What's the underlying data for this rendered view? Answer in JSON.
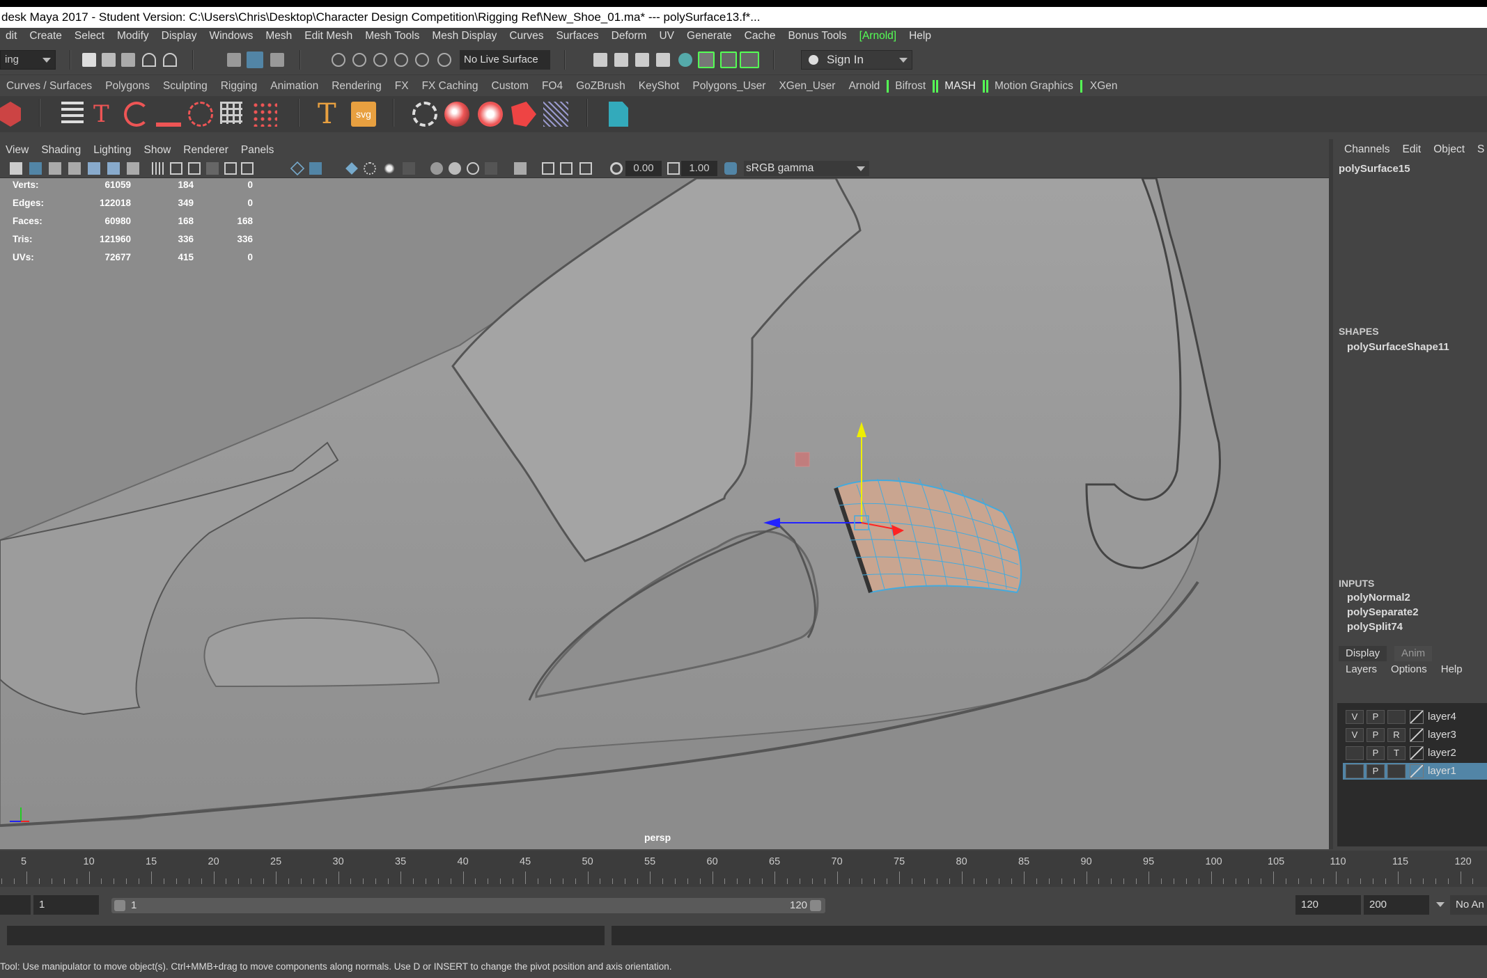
{
  "window": {
    "title": "desk Maya 2017 - Student Version: C:\\Users\\Chris\\Desktop\\Character Design Competition\\Rigging Ref\\New_Shoe_01.ma*   ---   polySurface13.f*..."
  },
  "menubar": [
    "dit",
    "Create",
    "Select",
    "Modify",
    "Display",
    "Windows",
    "Mesh",
    "Edit Mesh",
    "Mesh Tools",
    "Mesh Display",
    "Curves",
    "Surfaces",
    "Deform",
    "UV",
    "Generate",
    "Cache",
    "Bonus Tools",
    "[Arnold]",
    "Help"
  ],
  "statusline": {
    "mode_dropdown": "ing",
    "live_surface": "No Live Surface",
    "sign_in": "Sign In"
  },
  "shelf_tabs": [
    "Curves / Surfaces",
    "Polygons",
    "Sculpting",
    "Rigging",
    "Animation",
    "Rendering",
    "FX",
    "FX Caching",
    "Custom",
    "FO4",
    "GoZBrush",
    "KeyShot",
    "Polygons_User",
    "XGen_User",
    "Arnold",
    "Bifrost",
    "MASH",
    "Motion Graphics",
    "XGen"
  ],
  "viewport": {
    "menu": [
      "View",
      "Shading",
      "Lighting",
      "Show",
      "Renderer",
      "Panels"
    ],
    "exposure": "0.00",
    "gamma_value": "1.00",
    "color_space": "sRGB gamma",
    "camera": "persp",
    "hud": [
      {
        "label": "Verts:",
        "c1": "61059",
        "c2": "184",
        "c3": "0"
      },
      {
        "label": "Edges:",
        "c1": "122018",
        "c2": "349",
        "c3": "0"
      },
      {
        "label": "Faces:",
        "c1": "60980",
        "c2": "168",
        "c3": "168"
      },
      {
        "label": "Tris:",
        "c1": "121960",
        "c2": "336",
        "c3": "336"
      },
      {
        "label": "UVs:",
        "c1": "72677",
        "c2": "415",
        "c3": "0"
      }
    ]
  },
  "channel_box": {
    "menu": [
      "Channels",
      "Edit",
      "Object",
      "S"
    ],
    "object": "polySurface15",
    "shapes_header": "SHAPES",
    "shape": "polySurfaceShape11",
    "inputs_header": "INPUTS",
    "inputs": [
      "polyNormal2",
      "polySeparate2",
      "polySplit74"
    ]
  },
  "layer_editor": {
    "tabs": [
      "Display",
      "Anim"
    ],
    "menu": [
      "Layers",
      "Options",
      "Help"
    ],
    "layers": [
      {
        "v": "V",
        "p": "P",
        "r": "",
        "name": "layer4"
      },
      {
        "v": "V",
        "p": "P",
        "r": "R",
        "name": "layer3"
      },
      {
        "v": "",
        "p": "P",
        "r": "T",
        "name": "layer2"
      },
      {
        "v": "",
        "p": "P",
        "r": "",
        "name": "layer1"
      }
    ]
  },
  "timeline": {
    "ticks": [
      "5",
      "10",
      "15",
      "20",
      "25",
      "30",
      "35",
      "40",
      "45",
      "50",
      "55",
      "60",
      "65",
      "70",
      "75",
      "80",
      "85",
      "90",
      "95",
      "100",
      "105",
      "110",
      "115",
      "120"
    ]
  },
  "range": {
    "start": "1",
    "range_start": "1",
    "range_end": "120",
    "end": "120",
    "max": "200",
    "anim_layer": "No An"
  },
  "helpline": "Tool: Use manipulator to move object(s). Ctrl+MMB+drag to move components along normals. Use D or INSERT to change the pivot position and axis orientation.",
  "colors": {
    "panel": "#444444",
    "viewport_bg": "#8c8c8c",
    "selection": "#5285a6",
    "arnold_green": "#55ff55"
  }
}
